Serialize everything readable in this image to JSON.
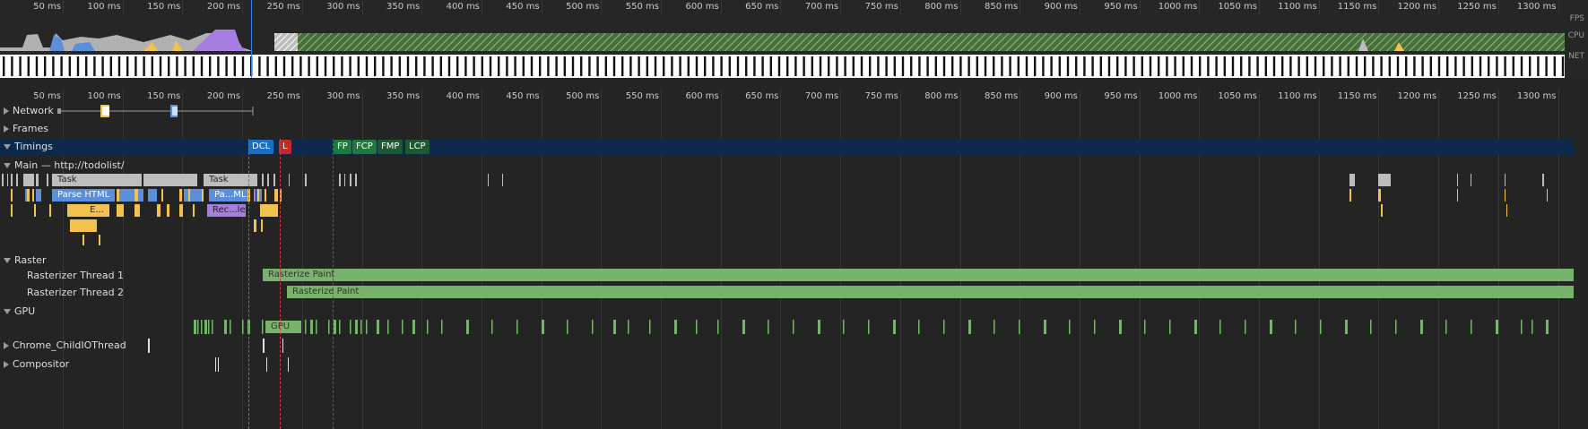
{
  "overview": {
    "fps_label": "FPS",
    "cpu_label": "CPU",
    "net_label": "NET",
    "ticks": [
      "50 ms",
      "100 ms",
      "150 ms",
      "200 ms",
      "250 ms",
      "300 ms",
      "350 ms",
      "400 ms",
      "450 ms",
      "500 ms",
      "550 ms",
      "600 ms",
      "650 ms",
      "700 ms",
      "750 ms",
      "800 ms",
      "850 ms",
      "900 ms",
      "950 ms",
      "1000 ms",
      "1050 ms",
      "1100 ms",
      "1150 ms",
      "1200 ms",
      "1250 ms",
      "1300 ms"
    ]
  },
  "timeline": {
    "ticks": [
      "50 ms",
      "100 ms",
      "150 ms",
      "200 ms",
      "250 ms",
      "300 ms",
      "350 ms",
      "400 ms",
      "450 ms",
      "500 ms",
      "550 ms",
      "600 ms",
      "650 ms",
      "700 ms",
      "750 ms",
      "800 ms",
      "850 ms",
      "900 ms",
      "950 ms",
      "1000 ms",
      "1050 ms",
      "1100 ms",
      "1150 ms",
      "1200 ms",
      "1250 ms",
      "1300 ms"
    ]
  },
  "tracks": {
    "network": "Network",
    "frames": "Frames",
    "timings": "Timings",
    "main": "Main — http://todolist/",
    "raster": "Raster",
    "raster1": "Rasterizer Thread 1",
    "raster2": "Rasterizer Thread 2",
    "gpu": "GPU",
    "childio": "Chrome_ChildIOThread",
    "compositor": "Compositor"
  },
  "markers": {
    "dcl": "DCL",
    "l": "L",
    "fp": "FP",
    "fcp": "FCP",
    "fmp": "FMP",
    "lcp": "LCP"
  },
  "events": {
    "task1": "Task",
    "task2": "Task",
    "parse_html": "Parse HTML",
    "parse_html_short": "Pa...ML",
    "evaluate_short": "E...",
    "recalc_short": "Rec...le",
    "rasterize1": "Rasterize Paint",
    "rasterize2": "Rasterize Paint",
    "gpu_task": "GPU"
  },
  "colors": {
    "background": "#242424",
    "timings_band": "#0d2a4d",
    "dcl": "#1a6fc4",
    "load": "#c62828",
    "paint_marker": "#1e7a3c",
    "raster": "#77b36a",
    "task": "#bdbdbd",
    "parse": "#5b8fd9",
    "script": "#f2c14e",
    "render": "#a67de0"
  }
}
